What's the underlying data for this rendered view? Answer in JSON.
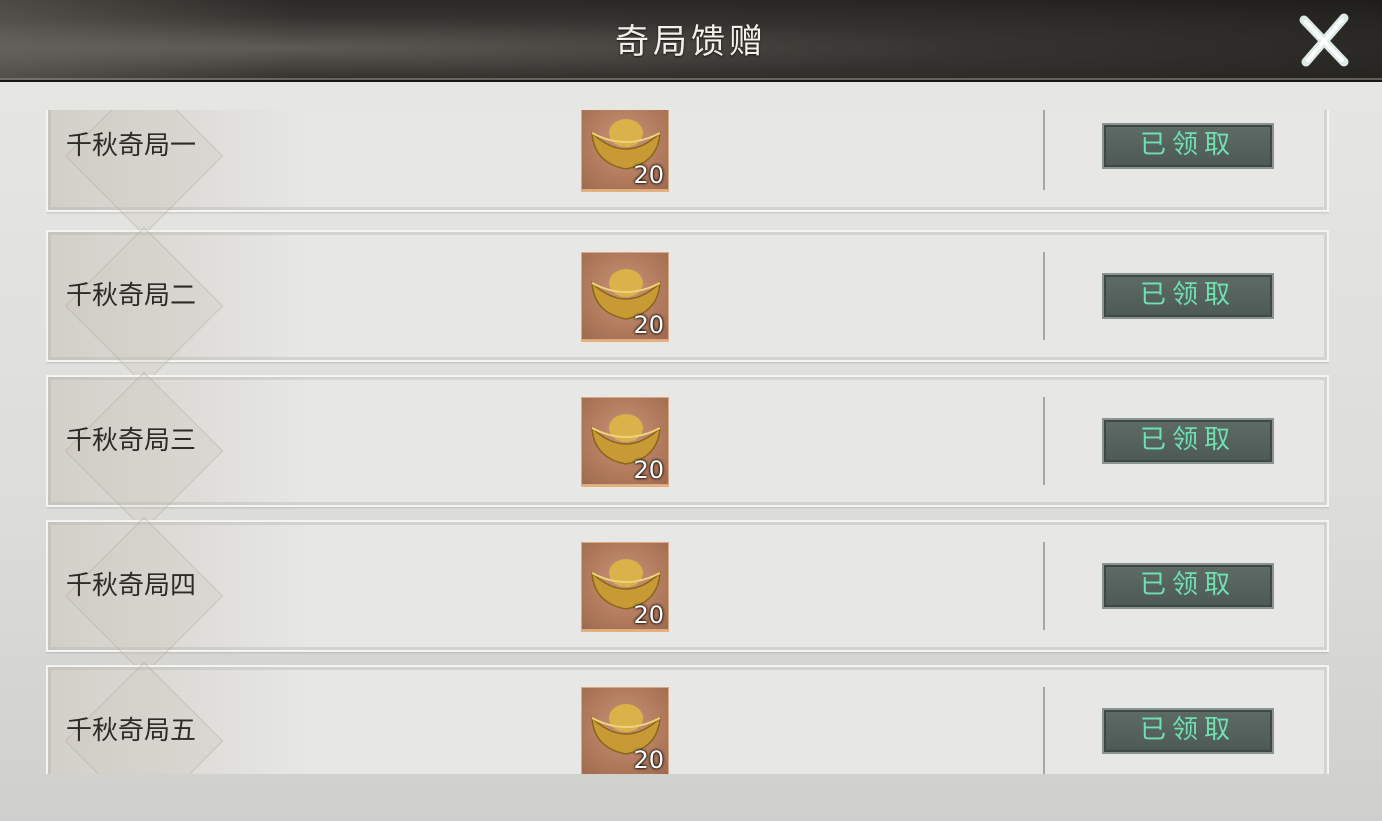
{
  "header": {
    "title": "奇局馈赠",
    "close_icon": "close-x-icon"
  },
  "rows": [
    {
      "name": "千秋奇局一",
      "reward_icon": "gold-ingot-icon",
      "reward_count": "20",
      "button_label": "已领取"
    },
    {
      "name": "千秋奇局二",
      "reward_icon": "gold-ingot-icon",
      "reward_count": "20",
      "button_label": "已领取"
    },
    {
      "name": "千秋奇局三",
      "reward_icon": "gold-ingot-icon",
      "reward_count": "20",
      "button_label": "已领取"
    },
    {
      "name": "千秋奇局四",
      "reward_icon": "gold-ingot-icon",
      "reward_count": "20",
      "button_label": "已领取"
    },
    {
      "name": "千秋奇局五",
      "reward_icon": "gold-ingot-icon",
      "reward_count": "20",
      "button_label": "已领取"
    }
  ],
  "colors": {
    "button_text": "#6fe0b2",
    "button_bg": "#55615d",
    "reward_bg": "#b17a5d"
  }
}
